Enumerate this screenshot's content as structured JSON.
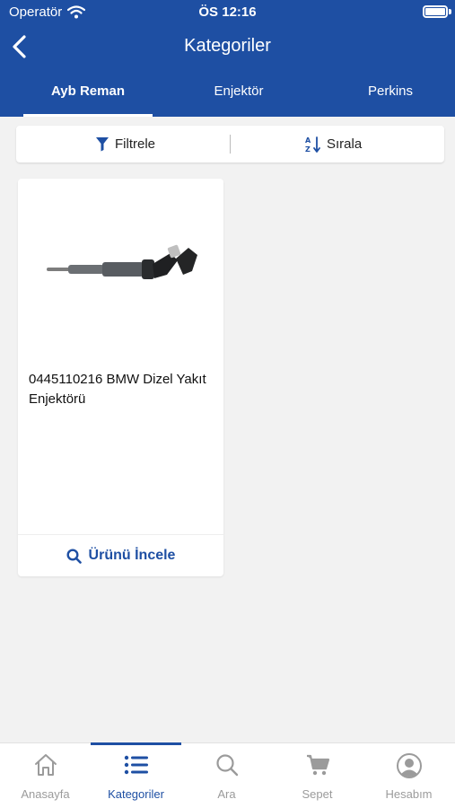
{
  "status": {
    "carrier": "Operatör",
    "time": "ÖS 12:16"
  },
  "nav": {
    "title": "Kategoriler"
  },
  "tabs": [
    {
      "label": "Ayb Reman",
      "active": true
    },
    {
      "label": "Enjektör",
      "active": false
    },
    {
      "label": "Perkins",
      "active": false
    }
  ],
  "filterbar": {
    "filter_label": "Filtrele",
    "sort_label": "Sırala"
  },
  "products": [
    {
      "title": "0445110216 BMW Dizel Yakıt Enjektörü",
      "action_label": "Ürünü İncele",
      "image_icon": "fuel-injector-image"
    }
  ],
  "bottom_nav": [
    {
      "label": "Anasayfa",
      "icon": "home-icon",
      "active": false
    },
    {
      "label": "Kategoriler",
      "icon": "list-icon",
      "active": true
    },
    {
      "label": "Ara",
      "icon": "search-icon",
      "active": false
    },
    {
      "label": "Sepet",
      "icon": "cart-icon",
      "active": false
    },
    {
      "label": "Hesabım",
      "icon": "user-icon",
      "active": false
    }
  ],
  "colors": {
    "brand": "#1e4fa3",
    "background": "#f2f2f2",
    "inactive": "#9b9b9b"
  }
}
